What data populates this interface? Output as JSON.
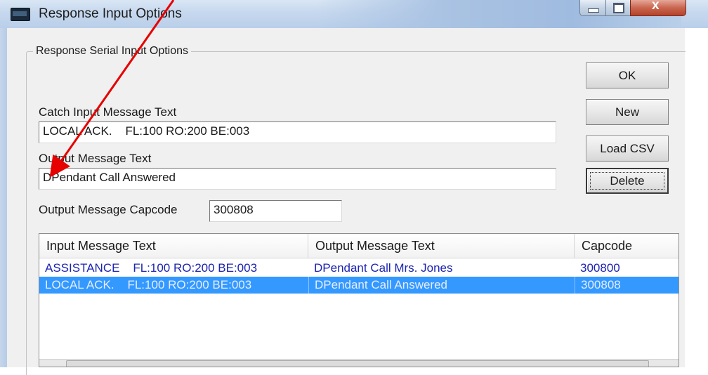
{
  "window": {
    "title": "Response Input Options"
  },
  "groupbox": {
    "label": "Response Serial Input Options"
  },
  "form": {
    "catch_input_label": "Catch Input Message Text",
    "catch_input_value": "LOCAL ACK.    FL:100 RO:200 BE:003",
    "output_message_label": "Output Message Text",
    "output_message_value": "DPendant Call Answered",
    "capcode_label": "Output Message Capcode",
    "capcode_value": "300808"
  },
  "buttons": {
    "ok": "OK",
    "new": "New",
    "load_csv": "Load CSV",
    "delete": "Delete"
  },
  "table": {
    "columns": [
      "Input Message Text",
      "Output Message Text",
      "Capcode"
    ],
    "rows": [
      {
        "input": "ASSISTANCE    FL:100 RO:200 BE:003",
        "output": "DPendant Call Mrs. Jones",
        "capcode": "300800",
        "selected": false
      },
      {
        "input": "LOCAL ACK.    FL:100 RO:200 BE:003",
        "output": "DPendant Call Answered",
        "capcode": "300808",
        "selected": true
      }
    ]
  },
  "colors": {
    "selection": "#3399ff",
    "row_text": "#1d24b0",
    "annotation_arrow": "#e60000"
  }
}
